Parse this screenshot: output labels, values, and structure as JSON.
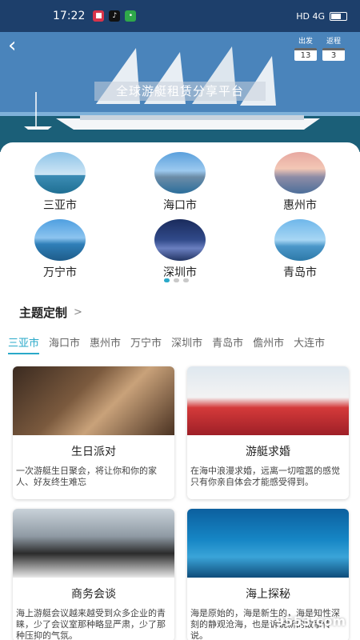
{
  "status": {
    "time": "17:22",
    "right_text": "HD 4G"
  },
  "hero": {
    "title": "全球游艇租赁分享平台",
    "checkin_label": "出发",
    "checkin_day": "13",
    "duration_label": "返程",
    "duration_day": "3"
  },
  "cities": [
    {
      "name": "三亚市"
    },
    {
      "name": "海口市"
    },
    {
      "name": "惠州市"
    },
    {
      "name": "万宁市"
    },
    {
      "name": "深圳市"
    },
    {
      "name": "青岛市"
    }
  ],
  "theme": {
    "heading": "主题定制",
    "chevron": ">",
    "tabs": [
      "三亚市",
      "海口市",
      "惠州市",
      "万宁市",
      "深圳市",
      "青岛市",
      "儋州市",
      "大连市"
    ],
    "active_tab": 0
  },
  "cards": [
    {
      "title": "生日派对",
      "desc": "一次游艇生日聚会，将让你和你的家人、好友终生难忘"
    },
    {
      "title": "游艇求婚",
      "desc": "在海中浪漫求婚，远离一切喧嚣的感觉只有你亲自体会才能感受得到。"
    },
    {
      "title": "商务会谈",
      "desc": "海上游艇会议越来越受到众多企业的青睐，少了会议室那种略显严肃，少了那种压抑的气氛。"
    },
    {
      "title": "海上探秘",
      "desc": "海是原始的，海是新生的，海是知性深刻的静观沧海，也是诉说新的故事传说。"
    }
  ],
  "watermark": "9553.com",
  "colors": {
    "accent": "#2aa9c9",
    "status_bg": "#1d3f6b"
  }
}
